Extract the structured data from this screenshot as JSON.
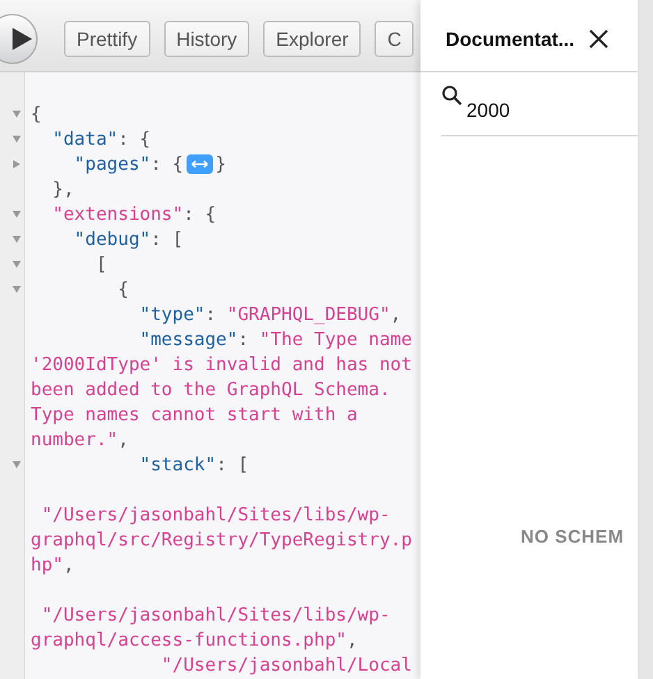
{
  "toolbar": {
    "buttons": [
      {
        "label": "Prettify"
      },
      {
        "label": "History"
      },
      {
        "label": "Explorer"
      },
      {
        "label": "C"
      }
    ]
  },
  "result": {
    "lines": [
      {
        "expanded": true,
        "parts": [
          {
            "tokens": [
              {
                "kind": "punct",
                "text": "{"
              }
            ]
          }
        ]
      },
      {
        "expanded": true,
        "parts": [
          {
            "tokens": [
              {
                "kind": "key",
                "text": "  \"data\""
              },
              {
                "kind": "punct",
                "text": ": {"
              }
            ]
          }
        ]
      },
      {
        "expanded": false,
        "parts": [
          {
            "tokens": [
              {
                "kind": "key",
                "text": "    \"pages\""
              },
              {
                "kind": "punct",
                "text": ": {"
              }
            ]
          },
          {
            "kind": "toggle"
          },
          {
            "tokens": [
              {
                "kind": "punct",
                "text": "}"
              }
            ]
          }
        ]
      },
      {
        "parts": [
          {
            "tokens": [
              {
                "kind": "punct",
                "text": "  },"
              }
            ]
          }
        ]
      },
      {
        "expanded": true,
        "parts": [
          {
            "tokens": [
              {
                "kind": "string",
                "text": "  \"extensions\""
              },
              {
                "kind": "punct",
                "text": ": {"
              }
            ]
          }
        ]
      },
      {
        "expanded": true,
        "parts": [
          {
            "tokens": [
              {
                "kind": "key",
                "text": "    \"debug\""
              },
              {
                "kind": "punct",
                "text": ": ["
              }
            ]
          }
        ]
      },
      {
        "expanded": true,
        "parts": [
          {
            "tokens": [
              {
                "kind": "punct",
                "text": "      ["
              }
            ]
          }
        ]
      },
      {
        "expanded": true,
        "parts": [
          {
            "tokens": [
              {
                "kind": "punct",
                "text": "        {"
              }
            ]
          }
        ]
      },
      {
        "parts": [
          {
            "tokens": [
              {
                "kind": "key",
                "text": "          \"type\""
              },
              {
                "kind": "punct",
                "text": ": "
              },
              {
                "kind": "string",
                "text": "\"GRAPHQL_DEBUG\""
              },
              {
                "kind": "punct",
                "text": ","
              }
            ]
          }
        ]
      },
      {
        "parts": [
          {
            "tokens": [
              {
                "kind": "key",
                "text": "          \"message\""
              },
              {
                "kind": "punct",
                "text": ": "
              },
              {
                "kind": "string",
                "text": "\"The Type name"
              }
            ]
          }
        ]
      },
      {
        "parts": [
          {
            "tokens": [
              {
                "kind": "string",
                "text": "'2000IdType' is invalid and has not"
              }
            ]
          }
        ]
      },
      {
        "parts": [
          {
            "tokens": [
              {
                "kind": "string",
                "text": "been added to the GraphQL Schema."
              }
            ]
          }
        ]
      },
      {
        "parts": [
          {
            "tokens": [
              {
                "kind": "string",
                "text": "Type names cannot start with a"
              }
            ]
          }
        ]
      },
      {
        "parts": [
          {
            "tokens": [
              {
                "kind": "string",
                "text": "number.\""
              },
              {
                "kind": "punct",
                "text": ","
              }
            ]
          }
        ]
      },
      {
        "expanded": true,
        "parts": [
          {
            "tokens": [
              {
                "kind": "key",
                "text": "          \"stack\""
              },
              {
                "kind": "punct",
                "text": ": ["
              }
            ]
          }
        ]
      },
      {
        "blank_before": true,
        "parts": [
          {
            "tokens": [
              {
                "kind": "string",
                "text": " \"/Users/jasonbahl/Sites/libs/wp-"
              }
            ]
          }
        ]
      },
      {
        "parts": [
          {
            "tokens": [
              {
                "kind": "string",
                "text": "graphql/src/Registry/TypeRegistry.p"
              }
            ]
          }
        ]
      },
      {
        "parts": [
          {
            "tokens": [
              {
                "kind": "string",
                "text": "hp\""
              },
              {
                "kind": "punct",
                "text": ","
              }
            ]
          }
        ]
      },
      {
        "blank_before": true,
        "parts": [
          {
            "tokens": [
              {
                "kind": "string",
                "text": " \"/Users/jasonbahl/Sites/libs/wp-"
              }
            ]
          }
        ]
      },
      {
        "parts": [
          {
            "tokens": [
              {
                "kind": "string",
                "text": "graphql/access-functions.php\""
              },
              {
                "kind": "punct",
                "text": ","
              }
            ]
          }
        ]
      },
      {
        "parts": [
          {
            "tokens": [
              {
                "kind": "string",
                "text": "            \"/Users/jasonbahl/Local"
              }
            ]
          }
        ]
      }
    ]
  },
  "docs": {
    "title": "Documentat...",
    "search": {
      "value": "2000"
    },
    "empty_message": "NO SCHEM"
  }
}
